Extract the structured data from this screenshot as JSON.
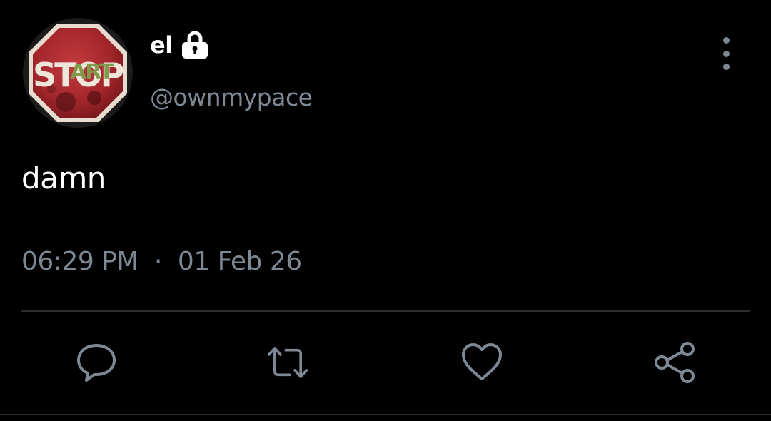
{
  "tweet": {
    "display_name": "el",
    "handle": "@ownmypace",
    "text": "damn",
    "time": "06:29 PM",
    "separator": "·",
    "date": "01 Feb 26"
  },
  "icons": {
    "lock": "lock-icon",
    "more": "vertical-ellipsis-icon",
    "reply": "speech-bubble-icon",
    "retweet": "retweet-icon",
    "like": "heart-icon",
    "share": "share-icon"
  },
  "avatar": {
    "sign_text_1": "STOP",
    "sign_text_2": "ART"
  },
  "colors": {
    "background": "#000000",
    "primary_text": "#ffffff",
    "secondary_text": "#7c8894",
    "divider": "#2a2f34",
    "sign_red": "#b02a2f"
  }
}
